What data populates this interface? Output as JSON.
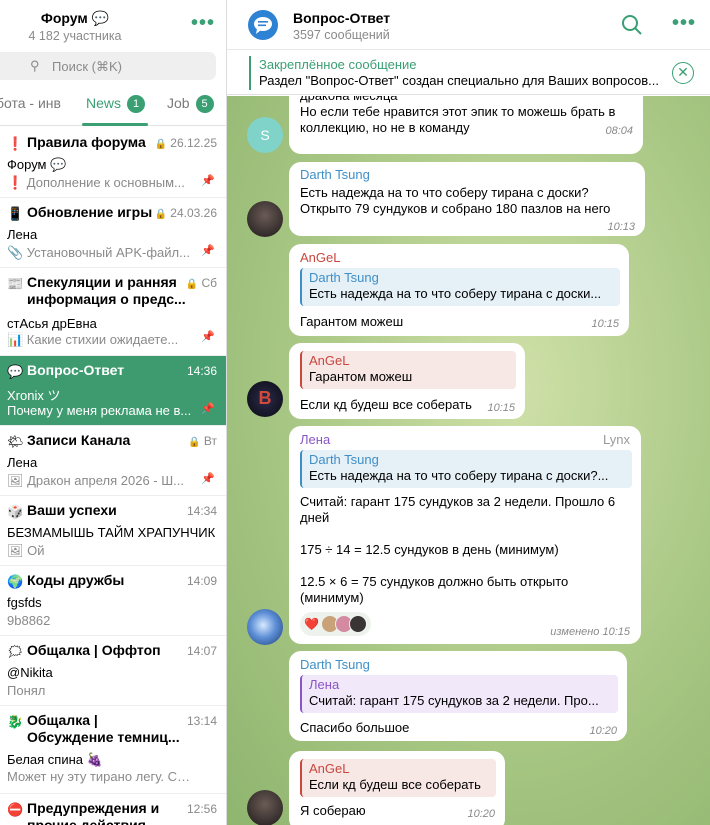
{
  "left": {
    "title": "Форум 💬",
    "subtitle": "4 182 участника",
    "search_placeholder": "Поиск (⌘K)",
    "tabs": [
      {
        "label": "бота - инв",
        "badge": ""
      },
      {
        "label": "News",
        "badge": "1"
      },
      {
        "label": "Job",
        "badge": "5"
      }
    ],
    "chats": [
      {
        "icon": "❗",
        "name": "Правила форума",
        "time": "26.12.25",
        "sender": "Форум 💬",
        "preview": "❗ Дополнение к основным...",
        "pinned": true,
        "locked": true
      },
      {
        "icon": "📱",
        "name": "Обновление игры",
        "time": "24.03.26",
        "sender": "Лена",
        "preview": "📎 Установочный APK-файл...",
        "pinned": true,
        "locked": true
      },
      {
        "icon": "📰",
        "name": "Спекуляции и ранняя информация о предс...",
        "time": "Сб",
        "sender": "стАсья дрЕвна",
        "preview": "📊 Какие стихии ожидаете...",
        "pinned": true,
        "locked": true
      },
      {
        "icon": "💬",
        "name": "Вопрос-Ответ",
        "time": "14:36",
        "sender": "Xronix ツ",
        "preview": "Почему у меня реклама не в...",
        "pinned": true,
        "locked": false
      },
      {
        "icon": "🌤",
        "name": "Записи Канала",
        "time": "Вт",
        "sender": "Лена",
        "preview": "🖼 Дракон апреля 2026 - Ш...",
        "pinned": true,
        "locked": true
      },
      {
        "icon": "🎲",
        "name": "Ваши успехи",
        "time": "14:34",
        "sender": "БЕЗМАМЫШЬ ТАЙМ ХРАПУНЧИК",
        "preview": "🖼 Ой",
        "pinned": false,
        "locked": false
      },
      {
        "icon": "🌍",
        "name": "Коды дружбы",
        "time": "14:09",
        "sender": "fgsfds",
        "preview": "9b8862",
        "pinned": false,
        "locked": false
      },
      {
        "icon": "🗯",
        "name": "Общалка | Оффтоп",
        "time": "14:07",
        "sender": "@Nikita",
        "preview": "Понял",
        "pinned": false,
        "locked": false
      },
      {
        "icon": "🐉",
        "name": "Общалка | Обсуждение темниц...",
        "time": "13:14",
        "sender": "Белая спина 🍇",
        "preview": "Может ну эту тирано легу. Соб...",
        "pinned": false,
        "locked": false
      },
      {
        "icon": "⛔",
        "name": "Предупреждения и прочие действия...",
        "time": "12:56",
        "sender": "",
        "preview": "",
        "pinned": false,
        "locked": false
      }
    ]
  },
  "right": {
    "title": "Вопрос-Ответ",
    "subtitle": "3597 сообщений",
    "pinned_title": "Закреплённое сообщение",
    "pinned_text": "Раздел \"Вопрос-Ответ\" создан специально для Ваших вопросов...",
    "messages": [
      {
        "avatar": "S",
        "lines": [
          "дракона месяца",
          "Но если тебе нравится этот эпик то можешь брать в",
          "коллекцию, но не в команду"
        ],
        "time": "08:04"
      },
      {
        "sender": "Darth Tsung",
        "lines": [
          "Есть надежда на то что соберу тирана с доски?",
          "Открыто 79 сундуков и собрано 180 пазлов на него"
        ],
        "time": "10:13"
      },
      {
        "sender": "AnGeL",
        "quote_name": "Darth Tsung",
        "quote_text": "Есть надежда на то что соберу тирана с доски...",
        "lines": [
          "Гарантом можеш"
        ],
        "time": "10:15"
      },
      {
        "quote_name": "AnGeL",
        "quote_text": "Гарантом можеш",
        "lines": [
          "Если кд будеш все соберать"
        ],
        "time": "10:15"
      },
      {
        "sender": "Лена",
        "tag": "Lynx",
        "quote_name": "Darth Tsung",
        "quote_text": "Есть надежда на то что соберу тирана с доски?...",
        "lines": [
          "Считай: гарант 175 сундуков за 2 недели. Прошло 6",
          "дней",
          "175 ÷ 14 = 12.5 сундуков в день (минимум)",
          "12.5 × 6 = 75 сундуков должно быть открыто",
          "(минимум)"
        ],
        "reaction": "❤️",
        "time": "изменено 10:15"
      },
      {
        "sender": "Darth Tsung",
        "quote_name": "Лена",
        "quote_text": "Считай: гарант 175 сундуков за 2 недели. Про...",
        "lines": [
          "Спасибо большое"
        ],
        "time": "10:20"
      },
      {
        "quote_name": "AnGeL",
        "quote_text": "Если кд будеш все соберать",
        "lines": [
          "Я собераю"
        ],
        "time": "10:20"
      }
    ]
  },
  "colors": {
    "accent": "#3a9f73",
    "darth": "#3f8fc7",
    "angel": "#c9473e",
    "lena": "#8a55c6"
  }
}
